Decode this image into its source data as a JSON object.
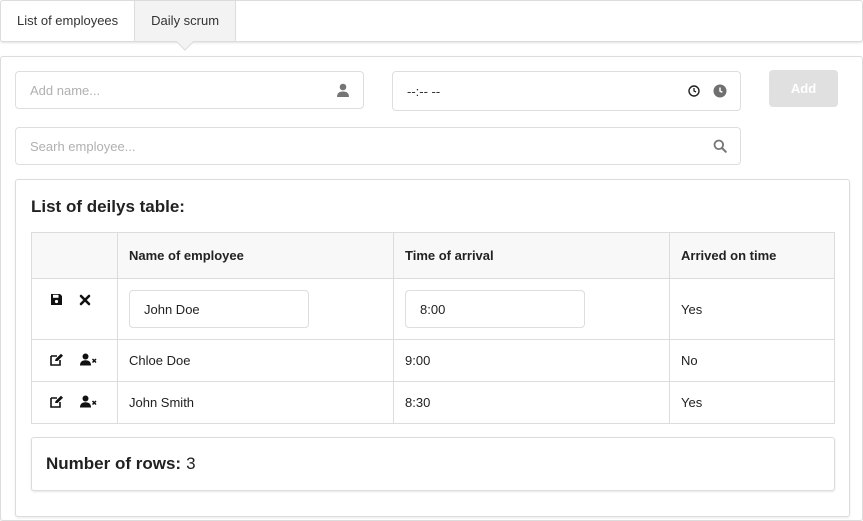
{
  "tabs": [
    {
      "label": "List of employees",
      "active": false
    },
    {
      "label": "Daily scrum",
      "active": true
    }
  ],
  "form": {
    "name_placeholder": "Add name...",
    "time_value": "--:-- --",
    "add_label": "Add",
    "search_placeholder": "Searh employee..."
  },
  "table": {
    "title": "List of deilys table:",
    "headers": [
      "",
      "Name of employee",
      "Time of arrival",
      "Arrived on time"
    ],
    "rows": [
      {
        "name": "John Doe",
        "time": "8:00",
        "on_time": "Yes",
        "editing": true
      },
      {
        "name": "Chloe Doe",
        "time": "9:00",
        "on_time": "No",
        "editing": false
      },
      {
        "name": "John Smith",
        "time": "8:30",
        "on_time": "Yes",
        "editing": false
      }
    ]
  },
  "summary": {
    "label": "Number of rows:",
    "value": "3"
  },
  "colors": {
    "accent_disabled": "#e0e0e0",
    "border": "#dcdcdc",
    "header_bg": "#f8f8f9"
  }
}
